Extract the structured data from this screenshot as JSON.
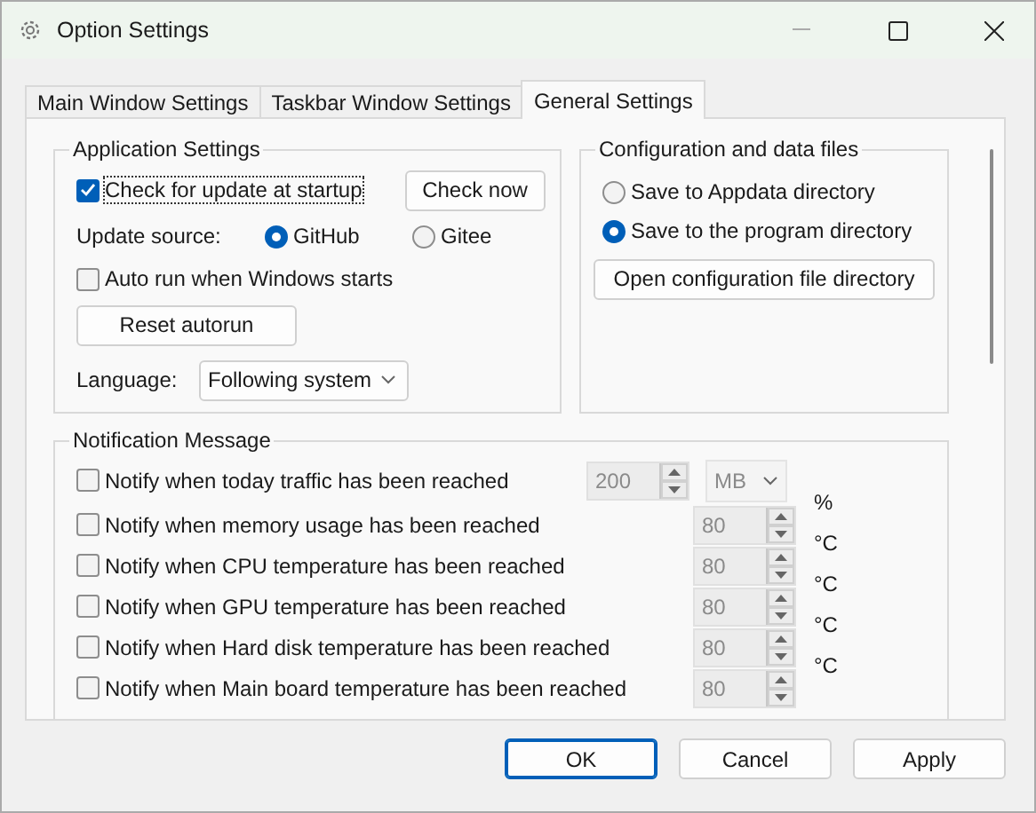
{
  "window": {
    "title": "Option Settings"
  },
  "tabs": [
    {
      "label": "Main Window Settings",
      "selected": false
    },
    {
      "label": "Taskbar Window Settings",
      "selected": false
    },
    {
      "label": "General Settings",
      "selected": true
    }
  ],
  "application_settings": {
    "title": "Application Settings",
    "check_update": {
      "label": "Check for update at startup",
      "checked": true
    },
    "check_now": "Check now",
    "update_source": {
      "label": "Update source:",
      "options": [
        {
          "label": "GitHub",
          "selected": true
        },
        {
          "label": "Gitee",
          "selected": false
        }
      ]
    },
    "auto_run": {
      "label": "Auto run when Windows starts",
      "checked": false
    },
    "reset_autorun": "Reset autorun",
    "language": {
      "label": "Language:",
      "value": "Following system"
    }
  },
  "config": {
    "title": "Configuration and data files",
    "options": [
      {
        "label": "Save to Appdata directory",
        "selected": false
      },
      {
        "label": "Save to the program directory",
        "selected": true
      }
    ],
    "open_button": "Open configuration file directory"
  },
  "notifications": {
    "title": "Notification Message",
    "items": [
      {
        "kind": "dropdown",
        "label": "Notify when today traffic has been reached",
        "checked": false,
        "value": "200",
        "unit": "MB"
      },
      {
        "kind": "text",
        "label": "Notify when memory usage has been reached",
        "checked": false,
        "value": "80",
        "unit": "%"
      },
      {
        "kind": "text",
        "label": "Notify when CPU temperature has been reached",
        "checked": false,
        "value": "80",
        "unit": "°C"
      },
      {
        "kind": "text",
        "label": "Notify when GPU temperature has been reached",
        "checked": false,
        "value": "80",
        "unit": "°C"
      },
      {
        "kind": "text",
        "label": "Notify when Hard disk temperature has been reached",
        "checked": false,
        "value": "80",
        "unit": "°C"
      },
      {
        "kind": "text",
        "label": "Notify when Main board temperature has been reached",
        "checked": false,
        "value": "80",
        "unit": "°C"
      }
    ]
  },
  "buttons": [
    {
      "label": "OK",
      "default": true
    },
    {
      "label": "Cancel",
      "default": false
    },
    {
      "label": "Apply",
      "default": false
    }
  ]
}
